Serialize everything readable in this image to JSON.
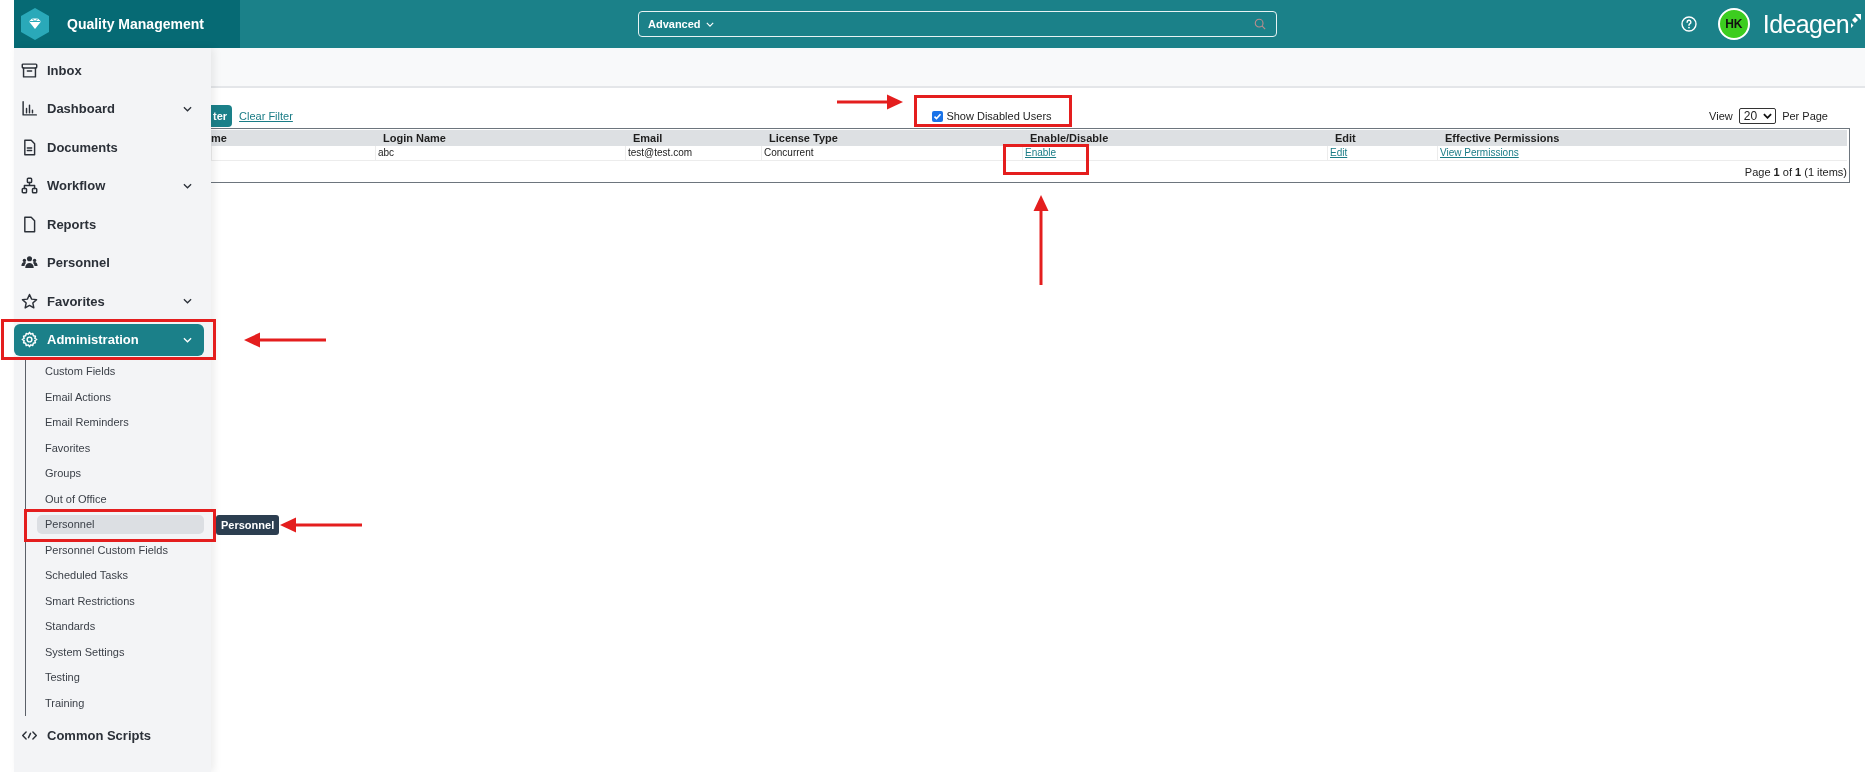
{
  "header": {
    "app_title": "Quality Management",
    "search": {
      "scope": "Advanced"
    },
    "avatar_initials": "HK",
    "brand": "Ideagen"
  },
  "sidebar": {
    "items": [
      {
        "label": "Inbox",
        "expandable": false,
        "selected": false,
        "highlighted": false
      },
      {
        "label": "Dashboard",
        "expandable": true,
        "selected": false,
        "highlighted": false
      },
      {
        "label": "Documents",
        "expandable": false,
        "selected": false,
        "highlighted": false
      },
      {
        "label": "Workflow",
        "expandable": true,
        "selected": false,
        "highlighted": false
      },
      {
        "label": "Reports",
        "expandable": false,
        "selected": false,
        "highlighted": false
      },
      {
        "label": "Personnel",
        "expandable": false,
        "selected": false,
        "highlighted": false
      },
      {
        "label": "Favorites",
        "expandable": true,
        "selected": false,
        "highlighted": false
      },
      {
        "label": "Administration",
        "expandable": true,
        "selected": true,
        "highlighted": true,
        "children": [
          {
            "label": "Custom Fields",
            "selected": false,
            "highlighted": false
          },
          {
            "label": "Email Actions",
            "selected": false,
            "highlighted": false
          },
          {
            "label": "Email Reminders",
            "selected": false,
            "highlighted": false
          },
          {
            "label": "Favorites",
            "selected": false,
            "highlighted": false
          },
          {
            "label": "Groups",
            "selected": false,
            "highlighted": false
          },
          {
            "label": "Out of Office",
            "selected": false,
            "highlighted": false
          },
          {
            "label": "Personnel",
            "selected": true,
            "highlighted": true,
            "tooltip": "Personnel"
          },
          {
            "label": "Personnel Custom Fields",
            "selected": false,
            "highlighted": false
          },
          {
            "label": "Scheduled Tasks",
            "selected": false,
            "highlighted": false
          },
          {
            "label": "Smart Restrictions",
            "selected": false,
            "highlighted": false
          },
          {
            "label": "Standards",
            "selected": false,
            "highlighted": false
          },
          {
            "label": "System Settings",
            "selected": false,
            "highlighted": false
          },
          {
            "label": "Testing",
            "selected": false,
            "highlighted": false
          },
          {
            "label": "Training",
            "selected": false,
            "highlighted": false
          }
        ]
      },
      {
        "label": "Common Scripts",
        "expandable": false,
        "selected": false,
        "highlighted": false
      }
    ]
  },
  "toolbar": {
    "filter_button": "ter",
    "clear_filter_link": "Clear Filter",
    "show_disabled": {
      "label": "Show Disabled Users",
      "checked": true,
      "highlighted": true
    },
    "view_label": "View",
    "per_page": {
      "value": "20"
    },
    "per_page_label": "Per Page"
  },
  "table": {
    "columns": [
      "me",
      "Login Name",
      "Email",
      "License Type",
      "Enable/Disable",
      "Edit",
      "Effective Permissions"
    ],
    "rows": [
      {
        "cells": [
          {
            "kind": "blank"
          },
          {
            "kind": "text",
            "text": "abc"
          },
          {
            "kind": "text",
            "text": "test@test.com"
          },
          {
            "kind": "text",
            "text": "Concurrent"
          },
          {
            "kind": "link",
            "text": "Enable",
            "highlighted": true
          },
          {
            "kind": "link",
            "text": "Edit",
            "highlighted": false
          },
          {
            "kind": "link",
            "text": "View Permissions",
            "highlighted": false
          }
        ]
      }
    ],
    "pager": "Page **1** of **1** (1 items)"
  }
}
